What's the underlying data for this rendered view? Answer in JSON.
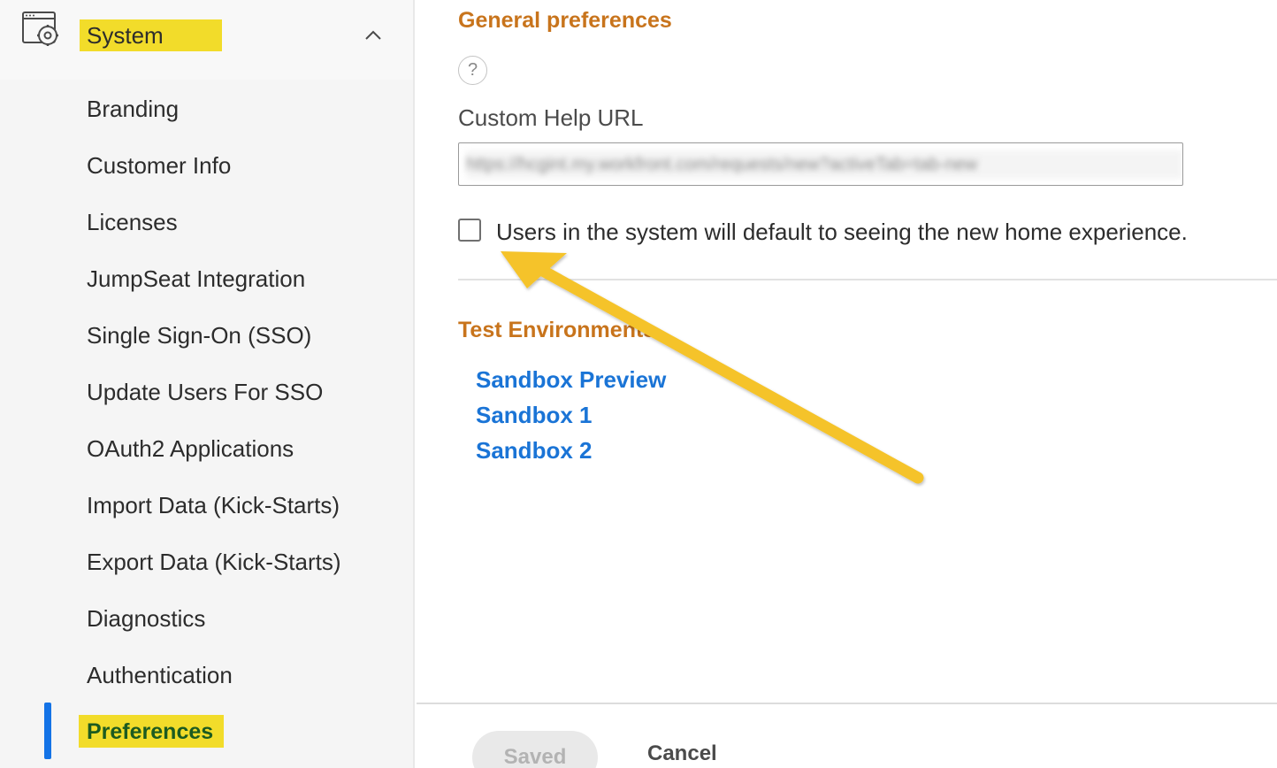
{
  "sidebar": {
    "section_label": "System",
    "items": [
      {
        "label": "Branding"
      },
      {
        "label": "Customer Info"
      },
      {
        "label": "Licenses"
      },
      {
        "label": "JumpSeat Integration"
      },
      {
        "label": "Single Sign-On (SSO)"
      },
      {
        "label": "Update Users For SSO"
      },
      {
        "label": "OAuth2 Applications"
      },
      {
        "label": "Import Data (Kick-Starts)"
      },
      {
        "label": "Export Data (Kick-Starts)"
      },
      {
        "label": "Diagnostics"
      },
      {
        "label": "Authentication"
      },
      {
        "label": "Preferences"
      }
    ],
    "active_item": "Preferences"
  },
  "main": {
    "general_title": "General preferences",
    "help_glyph": "?",
    "custom_help_label": "Custom Help URL",
    "custom_help_value": "https://hcgint.my.workfront.com/requests/new?activeTab=tab-new",
    "checkbox_label": "Users in the system will default to seeing the new home experience.",
    "checkbox_checked": false,
    "test_env_title": "Test Environments",
    "sandbox_links": [
      "Sandbox Preview",
      "Sandbox 1",
      "Sandbox 2"
    ]
  },
  "footer": {
    "saved_label": "Saved",
    "cancel_label": "Cancel"
  },
  "colors": {
    "highlight": "#f2dc2a",
    "section_title": "#c8741c",
    "link": "#1a74d6",
    "active_bar": "#1473e6",
    "annotation_arrow": "#f5c32c"
  }
}
